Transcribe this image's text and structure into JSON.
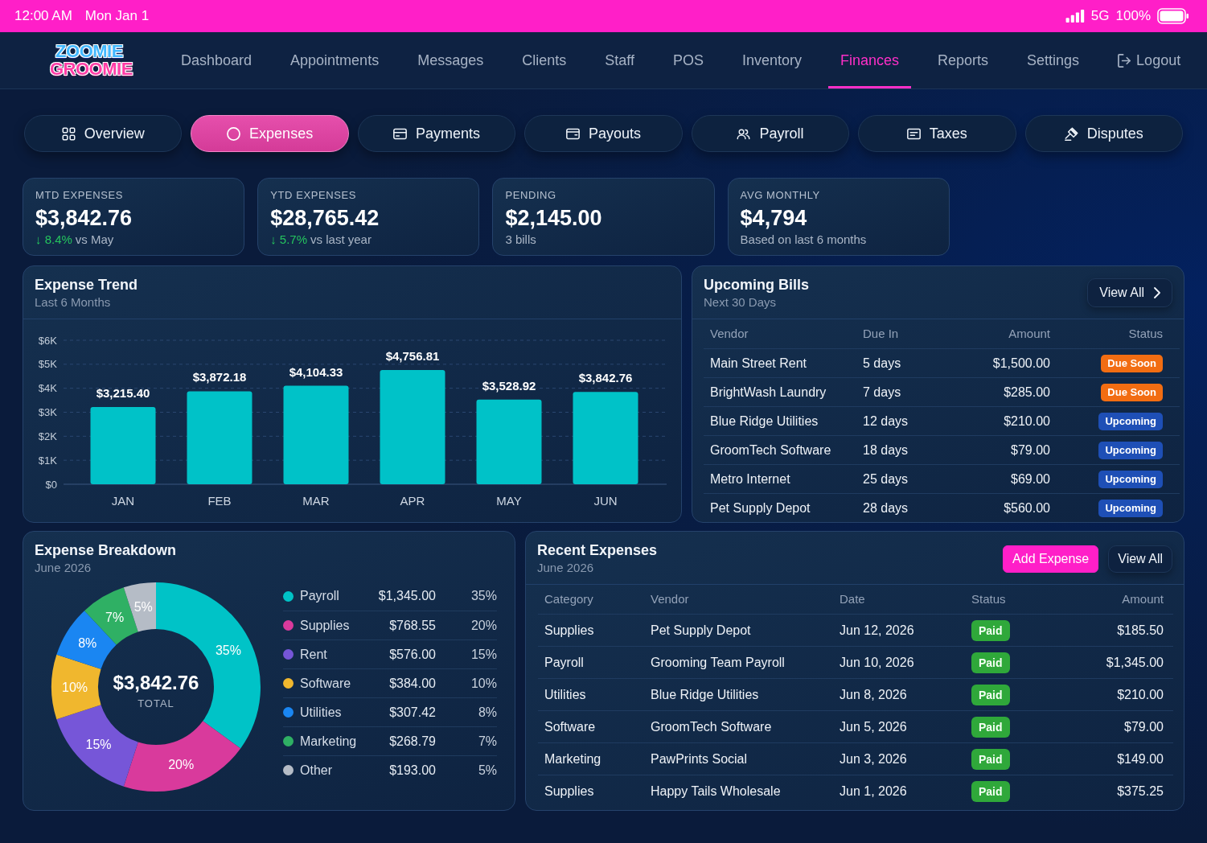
{
  "status_bar": {
    "time": "12:00 AM",
    "date": "Mon Jan 1",
    "network": "5G",
    "battery": "100%"
  },
  "navbar": {
    "logo": [
      "ZOOMIE",
      "GROOMIE"
    ],
    "items": [
      {
        "label": "Dashboard",
        "selected": false,
        "kind": "page"
      },
      {
        "label": "Appointments",
        "selected": false,
        "kind": "page"
      },
      {
        "label": "Messages",
        "selected": false,
        "kind": "page"
      },
      {
        "label": "Clients",
        "selected": false,
        "kind": "page"
      },
      {
        "label": "Staff",
        "selected": false,
        "kind": "page"
      },
      {
        "label": "POS",
        "selected": false,
        "kind": "page"
      },
      {
        "label": "Inventory",
        "selected": false,
        "kind": "page"
      },
      {
        "label": "Finances",
        "selected": true,
        "kind": "page"
      },
      {
        "label": "Reports",
        "selected": false,
        "kind": "page"
      },
      {
        "label": "Settings",
        "selected": false,
        "kind": "page"
      },
      {
        "label": "Logout",
        "selected": false,
        "kind": "action"
      }
    ]
  },
  "tabs": [
    {
      "label": "Overview",
      "selected": false
    },
    {
      "label": "Expenses",
      "selected": true
    },
    {
      "label": "Payments",
      "selected": false
    },
    {
      "label": "Payouts",
      "selected": false
    },
    {
      "label": "Payroll",
      "selected": false
    },
    {
      "label": "Taxes",
      "selected": false
    },
    {
      "label": "Disputes",
      "selected": false
    }
  ],
  "stats": [
    {
      "label": "MTD EXPENSES",
      "value": "$3,842.76",
      "change": "↓ 8.4%",
      "note": "vs May"
    },
    {
      "label": "YTD EXPENSES",
      "value": "$28,765.42",
      "change": "↓ 5.7%",
      "note": "vs last year"
    },
    {
      "label": "PENDING",
      "value": "$2,145.00",
      "note": "3 bills"
    },
    {
      "label": "AVG MONTHLY",
      "value": "$4,794",
      "note": "Based on last 6 months"
    }
  ],
  "expense_trend": {
    "title": "Expense Trend",
    "subtitle": "Last 6 Months",
    "chart_data": {
      "type": "bar",
      "categories": [
        "JAN",
        "FEB",
        "MAR",
        "APR",
        "MAY",
        "JUN"
      ],
      "values": [
        3215.4,
        3872.18,
        4104.33,
        4756.81,
        3528.92,
        3842.76
      ],
      "ylim": [
        0,
        6000
      ],
      "yticks": [
        {
          "value": 0,
          "label": "$0"
        },
        {
          "value": 1000,
          "label": "$1K"
        },
        {
          "value": 2000,
          "label": "$2K"
        },
        {
          "value": 3000,
          "label": "$3K"
        },
        {
          "value": 4000,
          "label": "$4K"
        },
        {
          "value": 5000,
          "label": "$5K"
        },
        {
          "value": 6000,
          "label": "$6K"
        }
      ],
      "grid": true,
      "value_labels": [
        "$3,215.40",
        "$3,872.18",
        "$4,104.33",
        "$4,756.81",
        "$3,528.92",
        "$3,842.76"
      ]
    }
  },
  "upcoming_bills": {
    "title": "Upcoming Bills",
    "subtitle": "Next 30 Days",
    "view_all": "View All",
    "columns": [
      "Vendor",
      "Due In",
      "Amount",
      "Status"
    ],
    "rows": [
      {
        "vendor": "Main Street Rent",
        "due_in": "5 days",
        "amount": "$1,500.00",
        "status": "Due Soon",
        "color": "#f26d12"
      },
      {
        "vendor": "BrightWash Laundry",
        "due_in": "7 days",
        "amount": "$285.00",
        "status": "Due Soon",
        "color": "#f26d12"
      },
      {
        "vendor": "Blue Ridge Utilities",
        "due_in": "12 days",
        "amount": "$210.00",
        "status": "Upcoming",
        "color": "#1e4fb6"
      },
      {
        "vendor": "GroomTech Software",
        "due_in": "18 days",
        "amount": "$79.00",
        "status": "Upcoming",
        "color": "#1e4fb6"
      },
      {
        "vendor": "Metro Internet",
        "due_in": "25 days",
        "amount": "$69.00",
        "status": "Upcoming",
        "color": "#1e4fb6"
      },
      {
        "vendor": "Pet Supply Depot",
        "due_in": "28 days",
        "amount": "$560.00",
        "status": "Upcoming",
        "color": "#1e4fb6"
      }
    ]
  },
  "expense_breakdown": {
    "title": "Expense Breakdown",
    "subtitle": "June 2026",
    "total": "$3,842.76",
    "total_label": "TOTAL",
    "chart_data": {
      "type": "donut",
      "categories": [
        "Payroll",
        "Supplies",
        "Rent",
        "Software",
        "Utilities",
        "Marketing",
        "Other"
      ],
      "values": [
        35,
        20,
        15,
        10,
        8,
        7,
        5
      ],
      "value_labels": [
        "35%",
        "20%",
        "15%",
        "10%",
        "8%",
        "7%",
        "5%"
      ]
    },
    "legend": [
      {
        "amount": "$1,345.00",
        "share": "35%",
        "color": "#00c3c7"
      },
      {
        "amount": "$768.55",
        "share": "20%",
        "color": "#d93a9c"
      },
      {
        "amount": "$576.00",
        "share": "15%",
        "color": "#7656d8"
      },
      {
        "amount": "$384.00",
        "share": "10%",
        "color": "#f0b72e"
      },
      {
        "amount": "$307.42",
        "share": "8%",
        "color": "#1a86f2"
      },
      {
        "amount": "$268.79",
        "share": "7%",
        "color": "#2fb064"
      },
      {
        "amount": "$193.00",
        "share": "5%",
        "color": "#b5bcc6"
      }
    ]
  },
  "recent_expenses": {
    "title": "Recent Expenses",
    "subtitle": "June 2026",
    "buttons": [
      {
        "label": "Add Expense",
        "kind": "primary"
      },
      {
        "label": "View All",
        "kind": "secondary"
      }
    ],
    "columns": [
      "Category",
      "Vendor",
      "Date",
      "Status",
      "Amount"
    ],
    "rows": [
      {
        "category": "Supplies",
        "vendor": "Pet Supply Depot",
        "date": "Jun 12, 2026",
        "status": "Paid",
        "amount": "$185.50"
      },
      {
        "category": "Payroll",
        "vendor": "Grooming Team Payroll",
        "date": "Jun 10, 2026",
        "status": "Paid",
        "amount": "$1,345.00"
      },
      {
        "category": "Utilities",
        "vendor": "Blue Ridge Utilities",
        "date": "Jun 8, 2026",
        "status": "Paid",
        "amount": "$210.00"
      },
      {
        "category": "Software",
        "vendor": "GroomTech Software",
        "date": "Jun 5, 2026",
        "status": "Paid",
        "amount": "$79.00"
      },
      {
        "category": "Marketing",
        "vendor": "PawPrints Social",
        "date": "Jun 3, 2026",
        "status": "Paid",
        "amount": "$149.00"
      },
      {
        "category": "Supplies",
        "vendor": "Happy Tails Wholesale",
        "date": "Jun 1, 2026",
        "status": "Paid",
        "amount": "$375.25"
      }
    ]
  }
}
